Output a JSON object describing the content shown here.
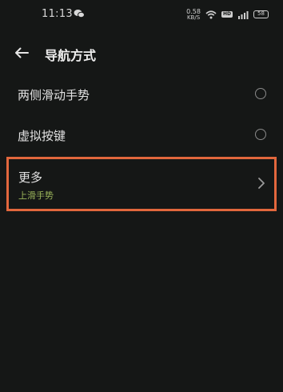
{
  "status_bar": {
    "time": "11:13",
    "net_speed_value": "0.58",
    "net_speed_unit": "KB/S",
    "hd_label": "HD",
    "battery": "58",
    "icons": [
      "wechat-icon",
      "wifi-icon",
      "signal-icon",
      "battery-icon"
    ]
  },
  "header": {
    "back_icon": "arrow-left-icon",
    "title": "导航方式"
  },
  "options": {
    "side_swipe": {
      "label": "两侧滑动手势",
      "selected": false
    },
    "virtual_keys": {
      "label": "虚拟按键",
      "selected": false
    },
    "more": {
      "label": "更多",
      "subtitle": "上滑手势",
      "icon": "chevron-right-icon"
    }
  },
  "colors": {
    "background": "#151716",
    "highlight_border": "#e2673d",
    "subtitle": "#9bb55a"
  }
}
